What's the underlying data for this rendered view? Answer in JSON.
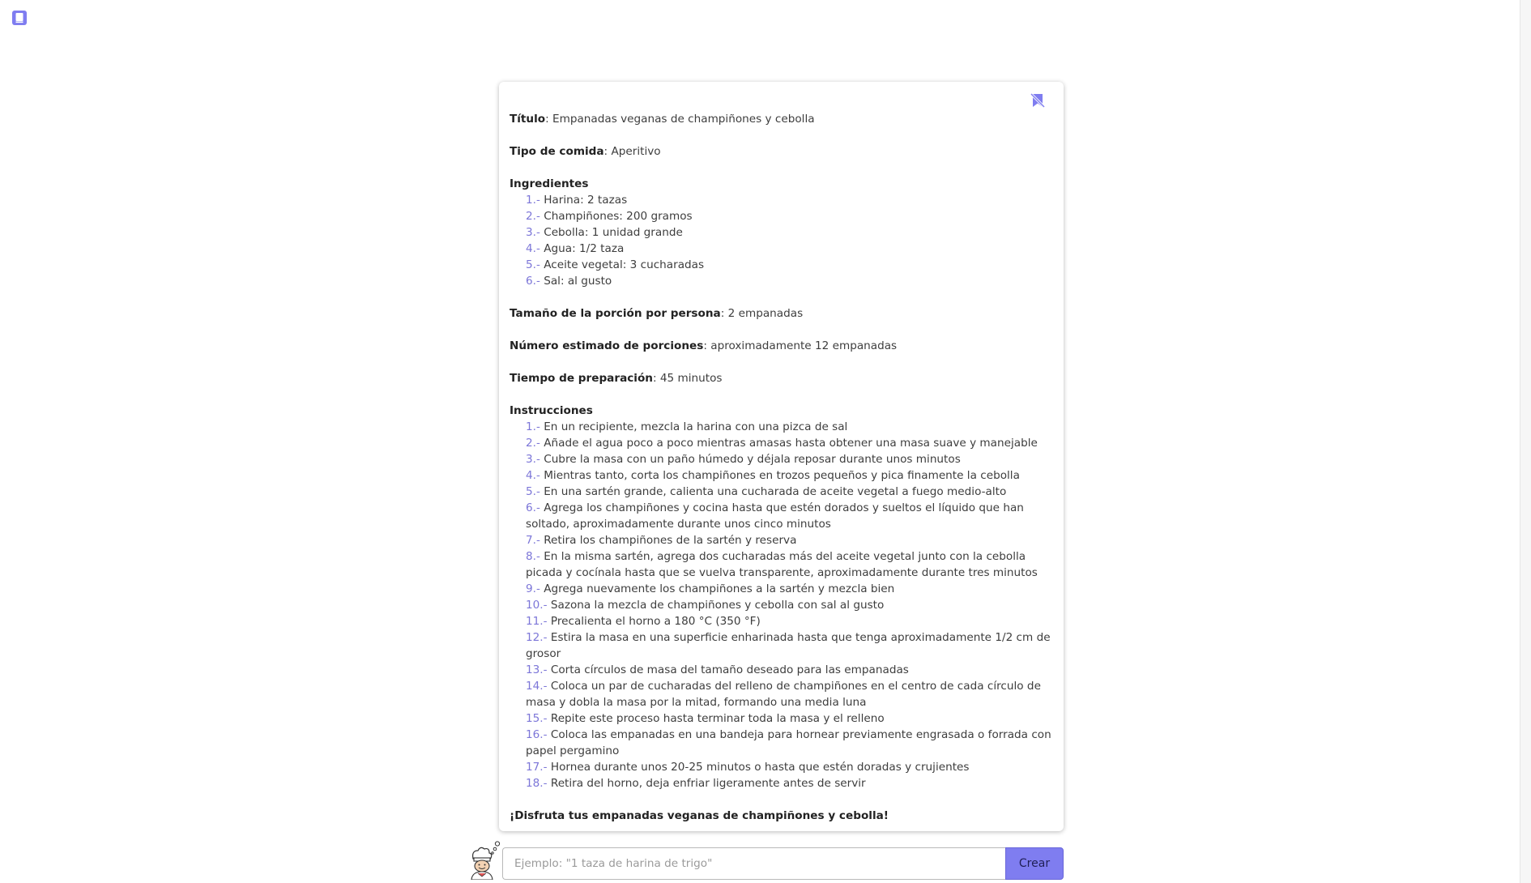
{
  "icons": {
    "book": "book-icon",
    "bookmark_off": "bookmark-slash-icon",
    "chef": "chef-avatar-icon"
  },
  "colors": {
    "accent": "#7f7df0",
    "list_number": "#7c76d8"
  },
  "recipe": {
    "title_label": "Título",
    "title_value": "Empanadas veganas de champiñones y cebolla",
    "type_label": "Tipo de comida",
    "type_value": "Aperitivo",
    "ingredients_label": "Ingredientes",
    "ingredients": [
      {
        "num": "1.-",
        "text": "Harina: 2 tazas"
      },
      {
        "num": "2.-",
        "text": "Champiñones: 200 gramos"
      },
      {
        "num": "3.-",
        "text": "Cebolla: 1 unidad grande"
      },
      {
        "num": "4.-",
        "text": "Agua: 1/2 taza"
      },
      {
        "num": "5.-",
        "text": "Aceite vegetal: 3 cucharadas"
      },
      {
        "num": "6.-",
        "text": "Sal: al gusto"
      }
    ],
    "portion_label": "Tamaño de la porción por persona",
    "portion_value": "2 empanadas",
    "servings_label": "Número estimado de porciones",
    "servings_value": "aproximadamente 12 empanadas",
    "time_label": "Tiempo de preparación",
    "time_value": "45 minutos",
    "instructions_label": "Instrucciones",
    "instructions": [
      {
        "num": "1.-",
        "text": "En un recipiente, mezcla la harina con una pizca de sal"
      },
      {
        "num": "2.-",
        "text": "Añade el agua poco a poco mientras amasas hasta obtener una masa suave y manejable"
      },
      {
        "num": "3.-",
        "text": "Cubre la masa con un paño húmedo y déjala reposar durante unos minutos"
      },
      {
        "num": "4.-",
        "text": "Mientras tanto, corta los champiñones en trozos pequeños y pica finamente la cebolla"
      },
      {
        "num": "5.-",
        "text": "En una sartén grande, calienta una cucharada de aceite vegetal a fuego medio-alto"
      },
      {
        "num": "6.-",
        "text": "Agrega los champiñones y cocina hasta que estén dorados y sueltos el líquido que han soltado, aproximadamente durante unos cinco minutos"
      },
      {
        "num": "7.-",
        "text": "Retira los champiñones de la sartén y reserva"
      },
      {
        "num": "8.-",
        "text": "En la misma sartén, agrega dos cucharadas más del aceite vegetal junto con la cebolla picada y cocínala hasta que se vuelva transparente, aproximadamente durante tres minutos"
      },
      {
        "num": "9.-",
        "text": "Agrega nuevamente los champiñones a la sartén y mezcla bien"
      },
      {
        "num": "10.-",
        "text": "Sazona la mezcla de champiñones y cebolla con sal al gusto"
      },
      {
        "num": "11.-",
        "text": "Precalienta el horno a 180 °C (350 °F)"
      },
      {
        "num": "12.-",
        "text": "Estira la masa en una superficie enharinada hasta que tenga aproximadamente 1/2 cm de grosor"
      },
      {
        "num": "13.-",
        "text": "Corta círculos de masa del tamaño deseado para las empanadas"
      },
      {
        "num": "14.-",
        "text": "Coloca un par de cucharadas del relleno de champiñones en el centro de cada círculo de masa y dobla la masa por la mitad, formando una media luna"
      },
      {
        "num": "15.-",
        "text": "Repite este proceso hasta terminar toda la masa y el relleno"
      },
      {
        "num": "16.-",
        "text": "Coloca las empanadas en una bandeja para hornear previamente engrasada o forrada con papel pergamino"
      },
      {
        "num": "17.-",
        "text": "Hornea durante unos 20-25 minutos o hasta que estén doradas y crujientes"
      },
      {
        "num": "18.-",
        "text": "Retira del horno, deja enfriar ligeramente antes de servir"
      }
    ],
    "closing": "¡Disfruta tus empanadas veganas de champiñones y cebolla!"
  },
  "input": {
    "placeholder": "Ejemplo: \"1 taza de harina de trigo\"",
    "value": ""
  },
  "create_button": "Crear"
}
